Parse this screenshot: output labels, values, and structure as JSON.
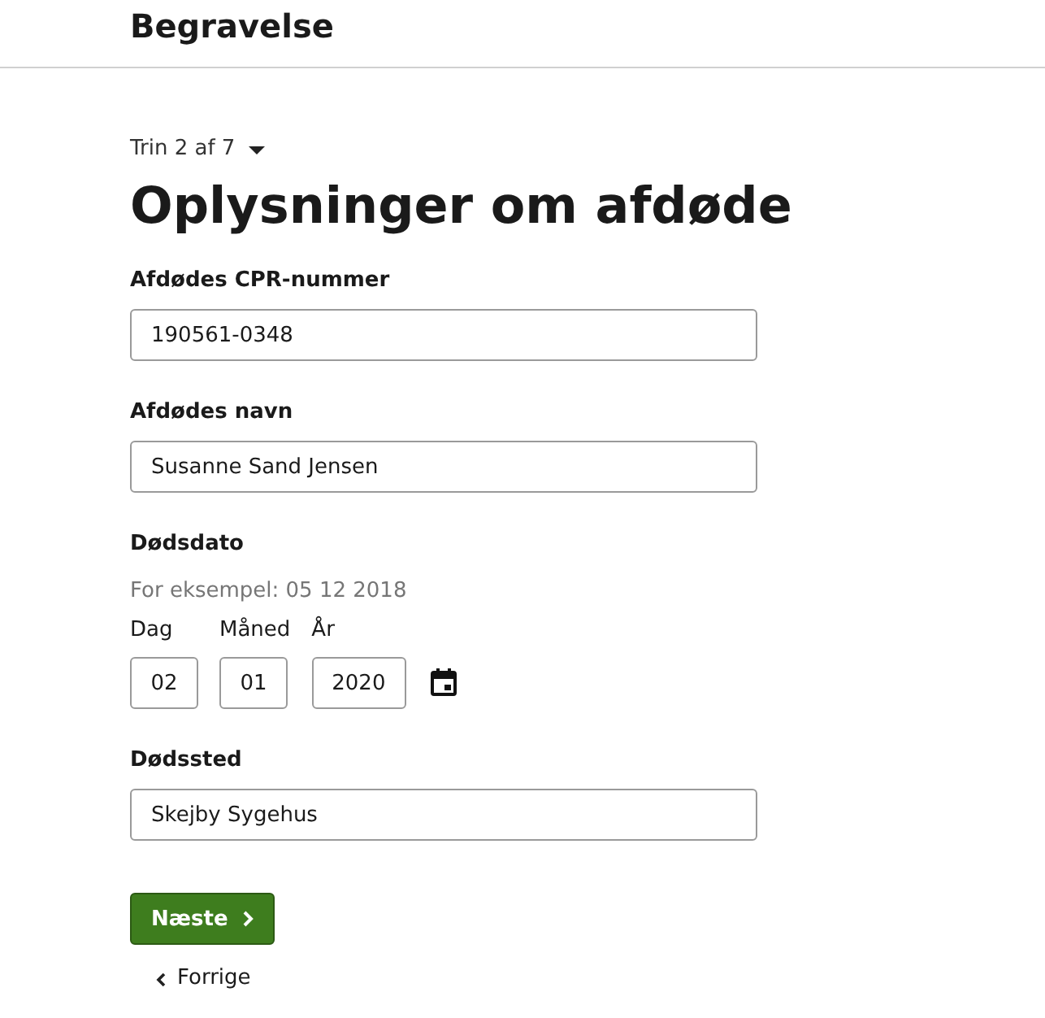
{
  "header": {
    "title": "Begravelse"
  },
  "step": {
    "text": "Trin 2 af 7"
  },
  "heading": "Oplysninger om afdøde",
  "fields": [
    {
      "kind": "text",
      "label": "Afdødes CPR-nummer",
      "value": "190561-0348"
    },
    {
      "kind": "text",
      "label": "Afdødes navn",
      "value": "Susanne Sand Jensen"
    },
    {
      "kind": "date",
      "label": "Dødsdato",
      "hint": "For eksempel: 05 12 2018",
      "parts": [
        {
          "label": "Dag",
          "value": "02"
        },
        {
          "label": "Måned",
          "value": "01"
        },
        {
          "label": "År",
          "value": "2020"
        }
      ]
    },
    {
      "kind": "text",
      "label": "Dødssted",
      "value": "Skejby Sygehus"
    }
  ],
  "next_button": {
    "label": "Næste"
  },
  "previous_link": {
    "label": "Forrige"
  }
}
